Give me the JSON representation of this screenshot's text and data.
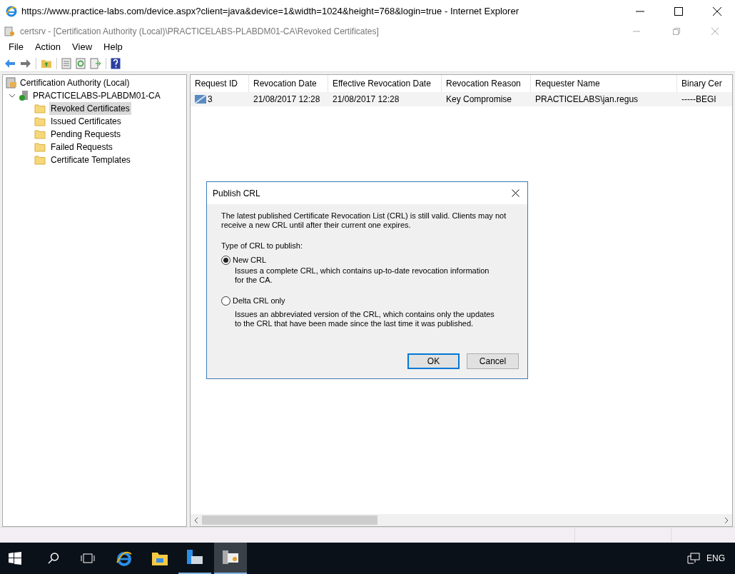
{
  "browser": {
    "title": "https://www.practice-labs.com/device.aspx?client=java&device=1&width=1024&height=768&login=true - Internet Explorer"
  },
  "window": {
    "title": "certsrv - [Certification Authority (Local)\\PRACTICELABS-PLABDM01-CA\\Revoked Certificates]"
  },
  "menu": [
    "File",
    "Action",
    "View",
    "Help"
  ],
  "tree": {
    "label": "Certification Authority (Local)",
    "children": [
      {
        "label": "PRACTICELABS-PLABDM01-CA",
        "expanded": true,
        "children": [
          {
            "label": "Revoked Certificates",
            "selected": true
          },
          {
            "label": "Issued Certificates",
            "selected": false
          },
          {
            "label": "Pending Requests",
            "selected": false
          },
          {
            "label": "Failed Requests",
            "selected": false
          },
          {
            "label": "Certificate Templates",
            "selected": false
          }
        ]
      }
    ]
  },
  "table": {
    "columns": [
      "Request ID",
      "Revocation Date",
      "Effective Revocation Date",
      "Revocation Reason",
      "Requester Name",
      "Binary Cer"
    ],
    "rows": [
      [
        "3",
        "21/08/2017 12:28",
        "21/08/2017 12:28",
        "Key Compromise",
        "PRACTICELABS\\jan.regus",
        "-----BEGI"
      ]
    ]
  },
  "dialog": {
    "title": "Publish CRL",
    "message": "The latest published Certificate Revocation List (CRL) is still valid. Clients may not receive a new CRL until after their current one expires.",
    "prompt": "Type of CRL to publish:",
    "options": [
      {
        "label": "New CRL",
        "description": "Issues a complete CRL, which contains up-to-date revocation information for the CA.",
        "selected": true
      },
      {
        "label": "Delta CRL only",
        "description": "Issues an abbreviated version of the CRL, which contains only the updates to the CRL that have been made since the last time it was published.",
        "selected": false
      }
    ],
    "buttons": [
      "OK",
      "Cancel"
    ]
  },
  "taskbar": {
    "language": "ENG"
  }
}
